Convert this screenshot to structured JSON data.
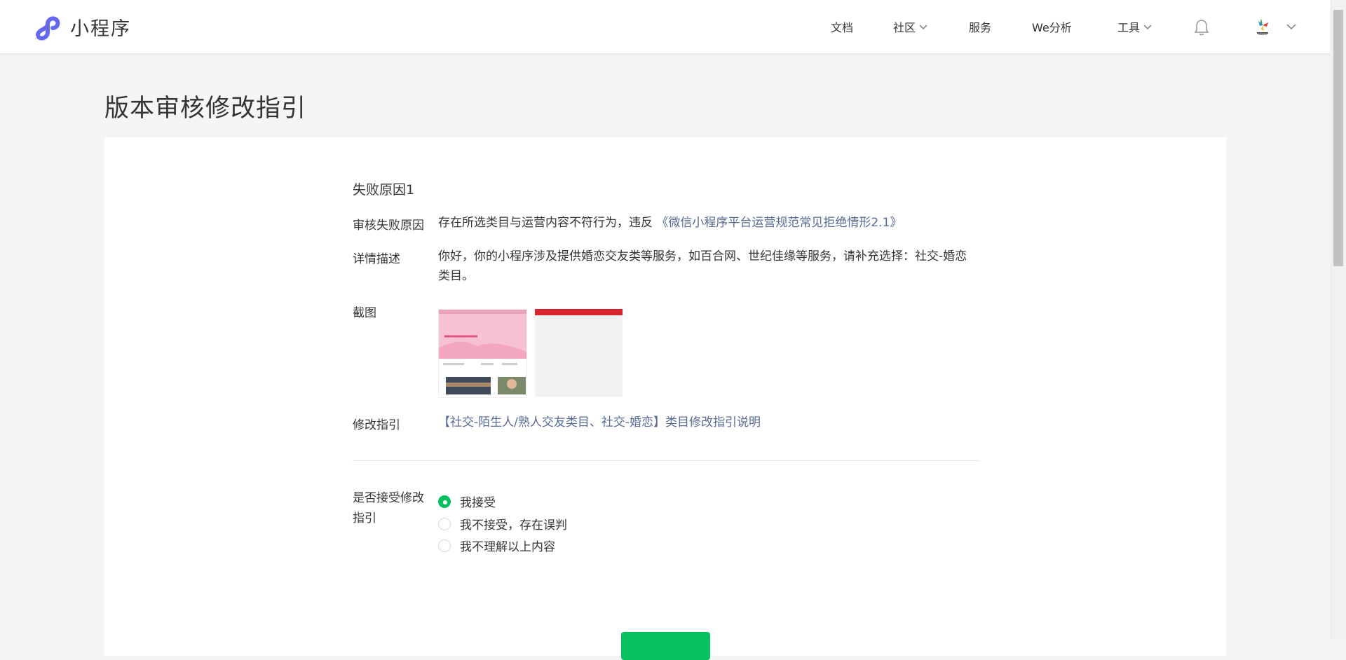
{
  "header": {
    "logo_text": "小程序",
    "nav": [
      {
        "label": "文档",
        "has_dropdown": false
      },
      {
        "label": "社区",
        "has_dropdown": true
      },
      {
        "label": "服务",
        "has_dropdown": false
      },
      {
        "label": "We分析",
        "has_dropdown": false
      },
      {
        "label": "工具",
        "has_dropdown": true
      }
    ],
    "icons": {
      "bell": "bell-icon",
      "avatar": "avatar",
      "account_menu": "chevron-down-icon"
    }
  },
  "page": {
    "title": "版本审核修改指引"
  },
  "failure": {
    "section_title": "失败原因1",
    "reason_label": "审核失败原因",
    "reason_text": "存在所选类目与运营内容不符行为，违反",
    "reason_link": "《微信小程序平台运营规范常见拒绝情形2.1》",
    "detail_label": "详情描述",
    "detail_text": "你好，你的小程序涉及提供婚恋交友类等服务，如百合网、世纪佳缘等服务，请补充选择：社交-婚恋类目。",
    "screenshot_label": "截图",
    "guide_label": "修改指引",
    "guide_link": "【社交-陌生人/熟人交友类目、社交-婚恋】类目修改指引说明"
  },
  "acceptance": {
    "label": "是否接受修改指引",
    "options": [
      {
        "label": "我接受",
        "checked": true
      },
      {
        "label": "我不接受，存在误判",
        "checked": false
      },
      {
        "label": "我不理解以上内容",
        "checked": false
      }
    ]
  },
  "colors": {
    "accent_green": "#07c160",
    "link_blue": "#576b95",
    "logo_purple": "#6467f0",
    "screenshot_red": "#d9252f"
  }
}
